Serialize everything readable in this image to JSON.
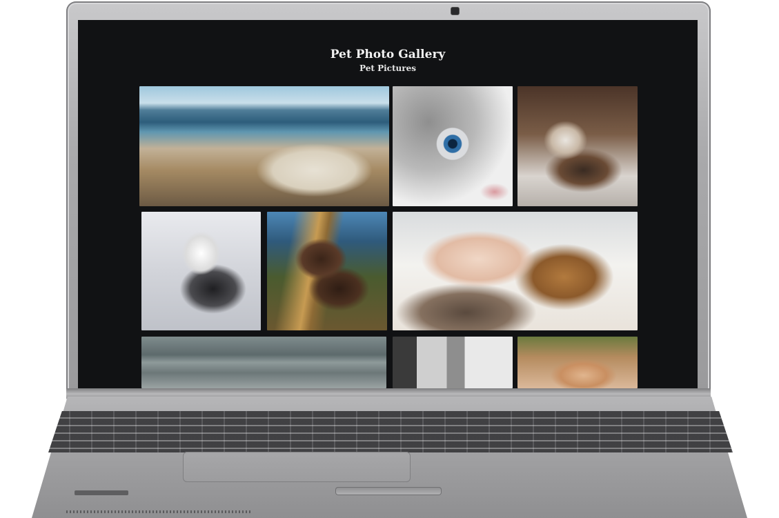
{
  "gallery": {
    "title": "Pet Photo Gallery",
    "subtitle": "Pet Pictures",
    "photos": [
      {
        "subject": "dog sleeping on beach"
      },
      {
        "subject": "white cat blue eye close-up"
      },
      {
        "subject": "kitten lying down"
      },
      {
        "subject": "husky in snow"
      },
      {
        "subject": "brown labrador with stick"
      },
      {
        "subject": "hand petting tabby cat"
      },
      {
        "subject": "stone steps"
      },
      {
        "subject": "cat by window"
      },
      {
        "subject": "ginger cat sleeping"
      }
    ]
  },
  "colors": {
    "screen_background": "#111214",
    "title_text": "#f2f2f2",
    "laptop_body": "#a9a9ab"
  }
}
